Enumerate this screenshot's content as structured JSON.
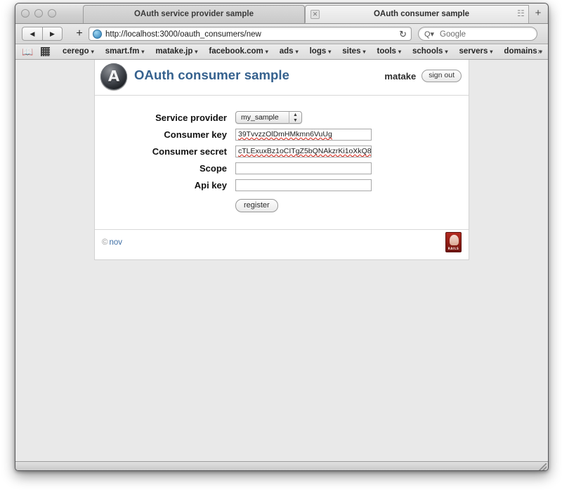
{
  "browser": {
    "tabs": [
      {
        "title": "OAuth service provider sample",
        "active": false,
        "has_close": false
      },
      {
        "title": "OAuth consumer sample",
        "active": true,
        "has_close": true,
        "close_icon": "close-icon"
      }
    ],
    "new_tab_label": "+",
    "tab_overflow_icon": "tab-overflow-icon",
    "toolbar": {
      "back_label": "◀",
      "forward_label": "▶",
      "add_label": "+",
      "url": "http://localhost:3000/oauth_consumers/new",
      "reload_label": "↻",
      "search_placeholder": "Google",
      "search_glyph": "Q▾",
      "site_icon": "globe-icon"
    },
    "bookmarks": {
      "book_icon": "book-icon",
      "grid_icon": "grid-icon",
      "overflow_label": "»",
      "items": [
        {
          "label": "cerego",
          "caret": "▾"
        },
        {
          "label": "smart.fm",
          "caret": "▾"
        },
        {
          "label": "matake.jp",
          "caret": "▾"
        },
        {
          "label": "facebook.com",
          "caret": "▾"
        },
        {
          "label": "ads",
          "caret": "▾"
        },
        {
          "label": "logs",
          "caret": "▾"
        },
        {
          "label": "sites",
          "caret": "▾"
        },
        {
          "label": "tools",
          "caret": "▾"
        },
        {
          "label": "schools",
          "caret": "▾"
        },
        {
          "label": "servers",
          "caret": "▾"
        },
        {
          "label": "domains",
          "caret": "▾"
        }
      ]
    }
  },
  "page": {
    "logo_icon": "oauth-logo-icon",
    "title": "OAuth consumer sample",
    "accent_color": "#35618e",
    "user": {
      "name": "matake",
      "sign_out_label": "sign out"
    },
    "form": {
      "fields": [
        {
          "label": "Service provider",
          "type": "select",
          "value": "my_sample",
          "name": "service-provider"
        },
        {
          "label": "Consumer key",
          "type": "text",
          "value": "39TvvzzOlDmHMkmn6VuUg",
          "placeholder": "",
          "spellcheck_underline": true,
          "name": "consumer-key"
        },
        {
          "label": "Consumer secret",
          "type": "text",
          "value": "cTLExuxBz1oCITgZ5bQNAkzrKi1oXkQ8",
          "placeholder": "",
          "spellcheck_underline": true,
          "name": "consumer-secret"
        },
        {
          "label": "Scope",
          "type": "text",
          "value": "",
          "placeholder": "",
          "spellcheck_underline": false,
          "name": "scope"
        },
        {
          "label": "Api key",
          "type": "text",
          "value": "",
          "placeholder": "",
          "spellcheck_underline": false,
          "name": "api-key"
        }
      ],
      "submit_label": "register"
    },
    "footer": {
      "copyright_mark": "©",
      "copyright_text": "nov",
      "badge_icon": "rails-badge-icon",
      "badge_text": "RAILS"
    }
  }
}
